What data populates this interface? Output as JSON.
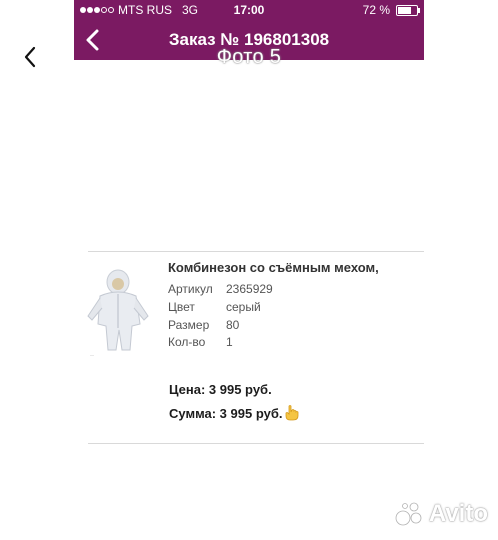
{
  "viewer": {
    "title": "Фото 5"
  },
  "status_bar": {
    "carrier": "MTS RUS",
    "network": "3G",
    "time": "17:00",
    "battery": "72 %",
    "battery_level": 0.72
  },
  "nav": {
    "title": "Заказ № 196801308"
  },
  "product": {
    "name": "Комбинезон со съёмным мехом,",
    "attributes": [
      {
        "label": "Артикул",
        "value": "2365929"
      },
      {
        "label": "Цвет",
        "value": "серый"
      },
      {
        "label": "Размер",
        "value": "80"
      },
      {
        "label": "Кол-во",
        "value": "1"
      }
    ],
    "price": "Цена: 3 995 руб.",
    "sum": "Сумма: 3 995 руб."
  },
  "watermark": "Avito"
}
